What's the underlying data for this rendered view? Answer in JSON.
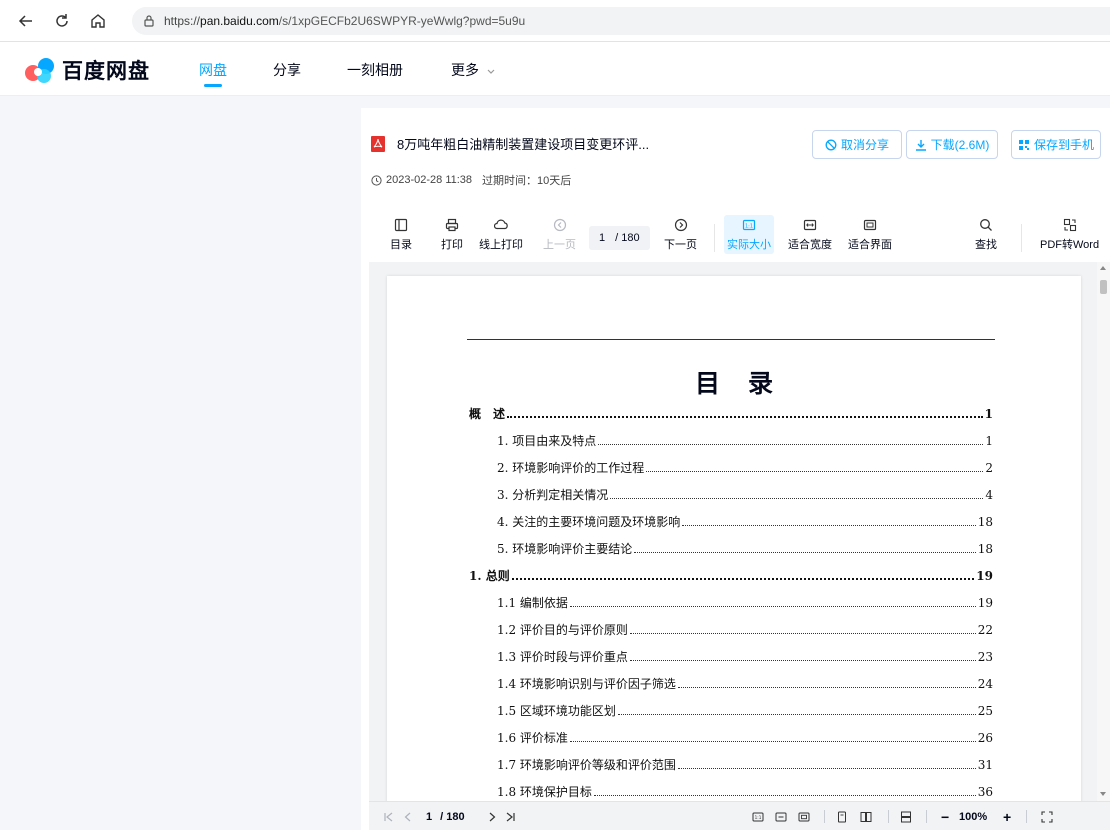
{
  "browser": {
    "url_prefix": "https://",
    "url_host": "pan.baidu.com",
    "url_rest": "/s/1xpGECFb2U6SWPYR-yeWwlg?pwd=5u9u"
  },
  "header": {
    "logo_part1": "百度",
    "logo_part2": "网盘",
    "nav": [
      "网盘",
      "分享",
      "一刻相册",
      "更多"
    ]
  },
  "file": {
    "name": "8万吨年粗白油精制装置建设项目变更环评...",
    "date": "2023-02-28 11:38",
    "expire": "过期时间：10天后",
    "actions": {
      "cancel_share": "取消分享",
      "download": "下载(2.6M)",
      "save_to_phone": "保存到手机"
    }
  },
  "toolbar": {
    "toc": "目录",
    "print": "打印",
    "online_print": "线上打印",
    "prev": "上一页",
    "page": "1",
    "total": "/ 180",
    "next": "下一页",
    "actual_size": "实际大小",
    "fit_width": "适合宽度",
    "fit_page": "适合界面",
    "find": "查找",
    "pdf_to_word": "PDF转Word"
  },
  "document": {
    "title": "目录",
    "entries": [
      {
        "label": "概　述",
        "page": "1",
        "level": 0,
        "bold": true
      },
      {
        "label": "1. 项目由来及特点",
        "page": "1",
        "level": 1
      },
      {
        "label": "2. 环境影响评价的工作过程",
        "page": "2",
        "level": 1
      },
      {
        "label": "3. 分析判定相关情况",
        "page": "4",
        "level": 1
      },
      {
        "label": "4. 关注的主要环境问题及环境影响",
        "page": "18",
        "level": 1
      },
      {
        "label": "5. 环境影响评价主要结论",
        "page": "18",
        "level": 1
      },
      {
        "label": "1. 总则",
        "page": "19",
        "level": 0,
        "bold": true
      },
      {
        "label": "1.1 编制依据",
        "page": "19",
        "level": 1
      },
      {
        "label": "1.2 评价目的与评价原则",
        "page": "22",
        "level": 1
      },
      {
        "label": "1.3 评价时段与评价重点",
        "page": "23",
        "level": 1
      },
      {
        "label": "1.4 环境影响识别与评价因子筛选",
        "page": "24",
        "level": 1
      },
      {
        "label": "1.5 区域环境功能区划",
        "page": "25",
        "level": 1
      },
      {
        "label": "1.6 评价标准",
        "page": "26",
        "level": 1
      },
      {
        "label": "1.7 环境影响评价等级和评价范围",
        "page": "31",
        "level": 1
      },
      {
        "label": "1.8 环境保护目标",
        "page": "36",
        "level": 1
      }
    ]
  },
  "bottom": {
    "page": "1",
    "total": "/ 180",
    "zoom": "100%",
    "minus": "−",
    "plus": "+"
  },
  "colors": {
    "accent": "#06a7ff",
    "text": "#03081a"
  }
}
